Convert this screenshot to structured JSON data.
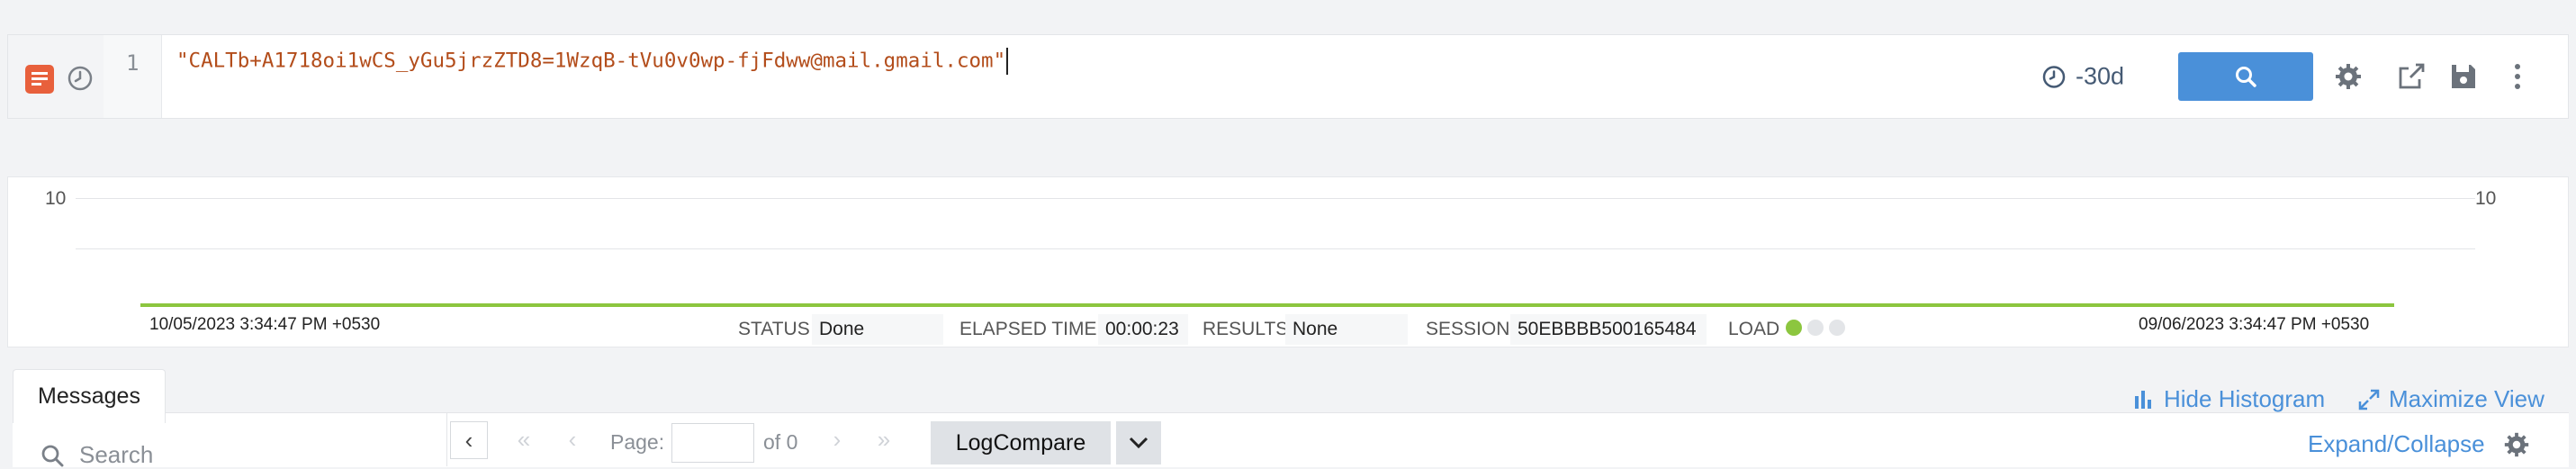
{
  "query": {
    "line_number": "1",
    "text": "\"CALTb+A1718oi1wCS_yGu5jrzZTD8=1WzqB-tVu0v0wp-fjFdww@mail.gmail.com\""
  },
  "toolbar": {
    "time_range": "-30d",
    "icons": [
      "log-search-icon",
      "recent-queries-icon",
      "clock-icon",
      "search-icon",
      "gear-icon",
      "share-icon",
      "save-icon",
      "more-vertical-icon"
    ]
  },
  "histogram": {
    "y_max_left": "10",
    "y_max_right": "10",
    "start_time": "10/05/2023 3:34:47 PM +0530",
    "end_time": "09/06/2023 3:34:47 PM +0530"
  },
  "stats": {
    "status_label": "STATUS",
    "status_value": "Done",
    "elapsed_label": "ELAPSED TIME",
    "elapsed_value": "00:00:23",
    "results_label": "RESULTS",
    "results_value": "None",
    "session_label": "SESSION",
    "session_value": "50EBBBB500165484",
    "load_label": "LOAD",
    "load_level": 1
  },
  "panel": {
    "tab_messages": "Messages",
    "hide_histogram": "Hide Histogram",
    "maximize_view": "Maximize View",
    "expand_collapse": "Expand/Collapse",
    "search_placeholder": "Search",
    "page_label": "Page:",
    "page_of": "of 0",
    "logcompare": "LogCompare"
  },
  "colors": {
    "accent": "#4a90d9",
    "query_text": "#b34d1b",
    "log_icon": "#e8603c",
    "load_green": "#8cc63f"
  }
}
